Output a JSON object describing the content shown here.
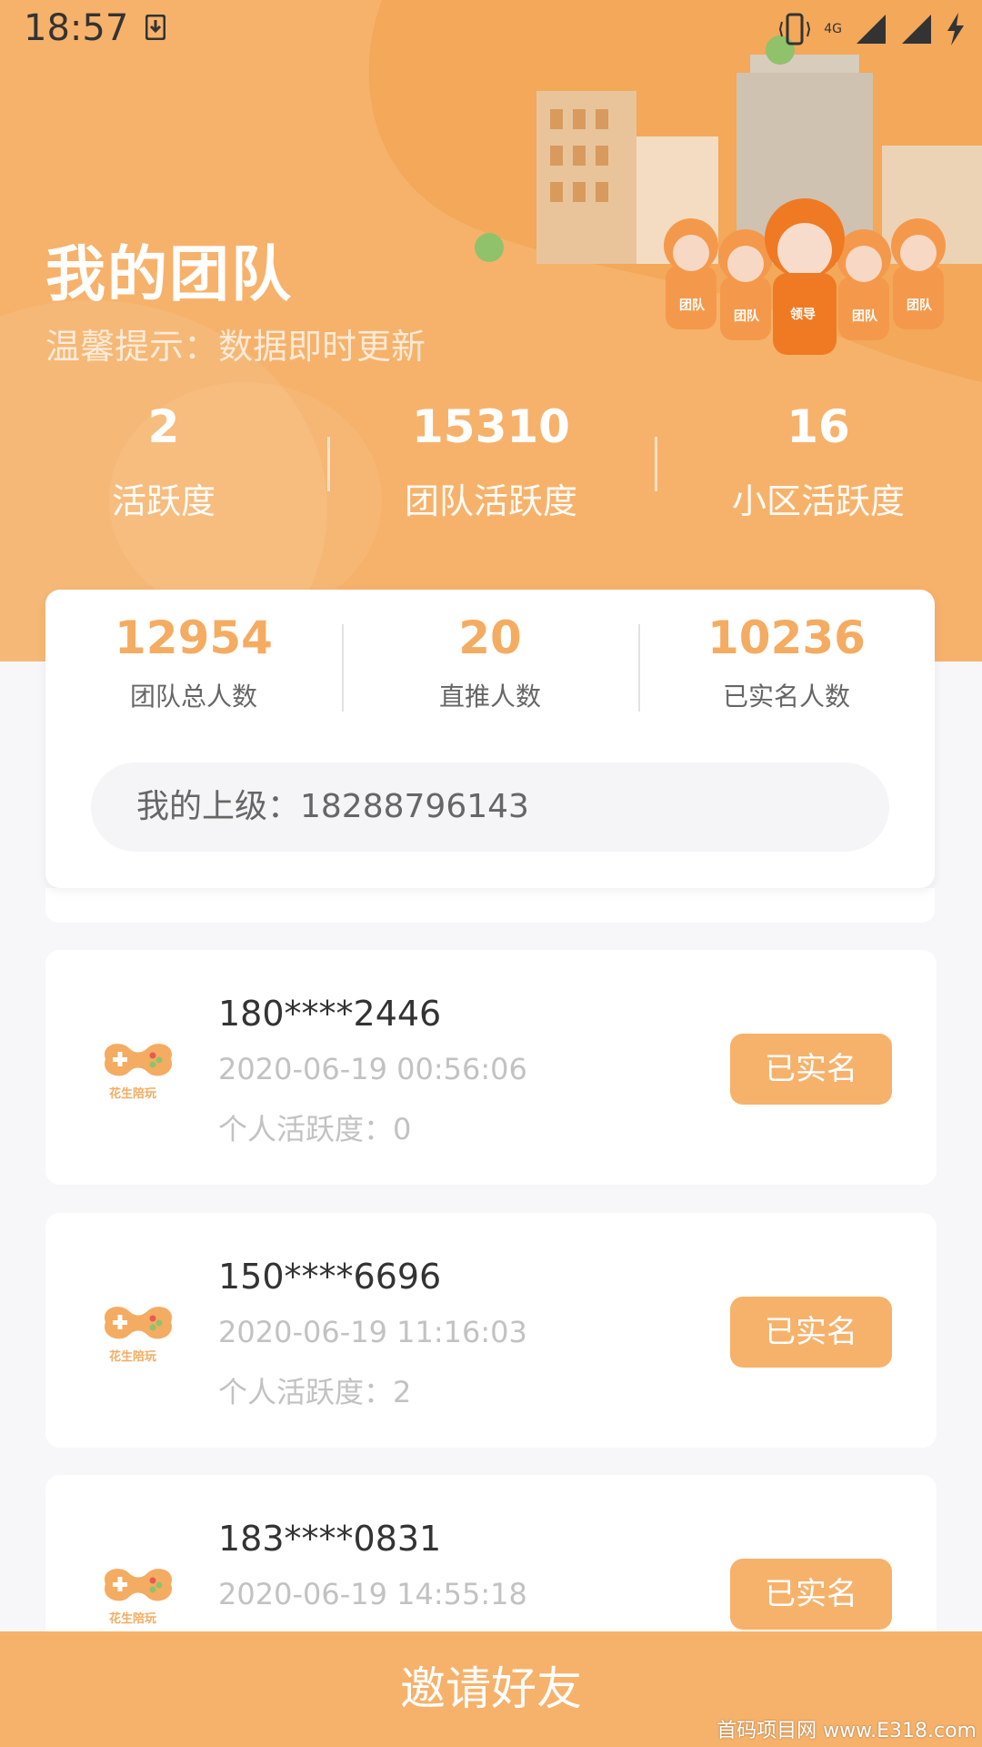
{
  "status_bar": {
    "time": "18:57",
    "network": "4G"
  },
  "header": {
    "title": "我的团队",
    "tip": "温馨提示：数据即时更新",
    "illustration_labels": [
      "团队",
      "团队",
      "领导",
      "团队",
      "团队"
    ]
  },
  "top_stats": [
    {
      "value": "2",
      "label": "活跃度"
    },
    {
      "value": "15310",
      "label": "团队活跃度"
    },
    {
      "value": "16",
      "label": "小区活跃度"
    }
  ],
  "summary": {
    "stats": [
      {
        "value": "12954",
        "label": "团队总人数"
      },
      {
        "value": "20",
        "label": "直推人数"
      },
      {
        "value": "10236",
        "label": "已实名人数"
      }
    ],
    "superior": "我的上级：18288796143"
  },
  "members": [
    {
      "phone": "180****2446",
      "time": "2020-06-19 00:56:06",
      "activity": "个人活跃度：0",
      "status": "已实名"
    },
    {
      "phone": "150****6696",
      "time": "2020-06-19 11:16:03",
      "activity": "个人活跃度：2",
      "status": "已实名"
    },
    {
      "phone": "183****0831",
      "time": "2020-06-19 14:55:18",
      "activity": "",
      "status": "已实名"
    }
  ],
  "logo_text": "花生陪玩",
  "invite_label": "邀请好友",
  "watermark": "首码项目网 www.E318.com",
  "colors": {
    "accent": "#f6b26b",
    "value_orange": "#f4ac62",
    "bg": "#f7f7fa"
  }
}
